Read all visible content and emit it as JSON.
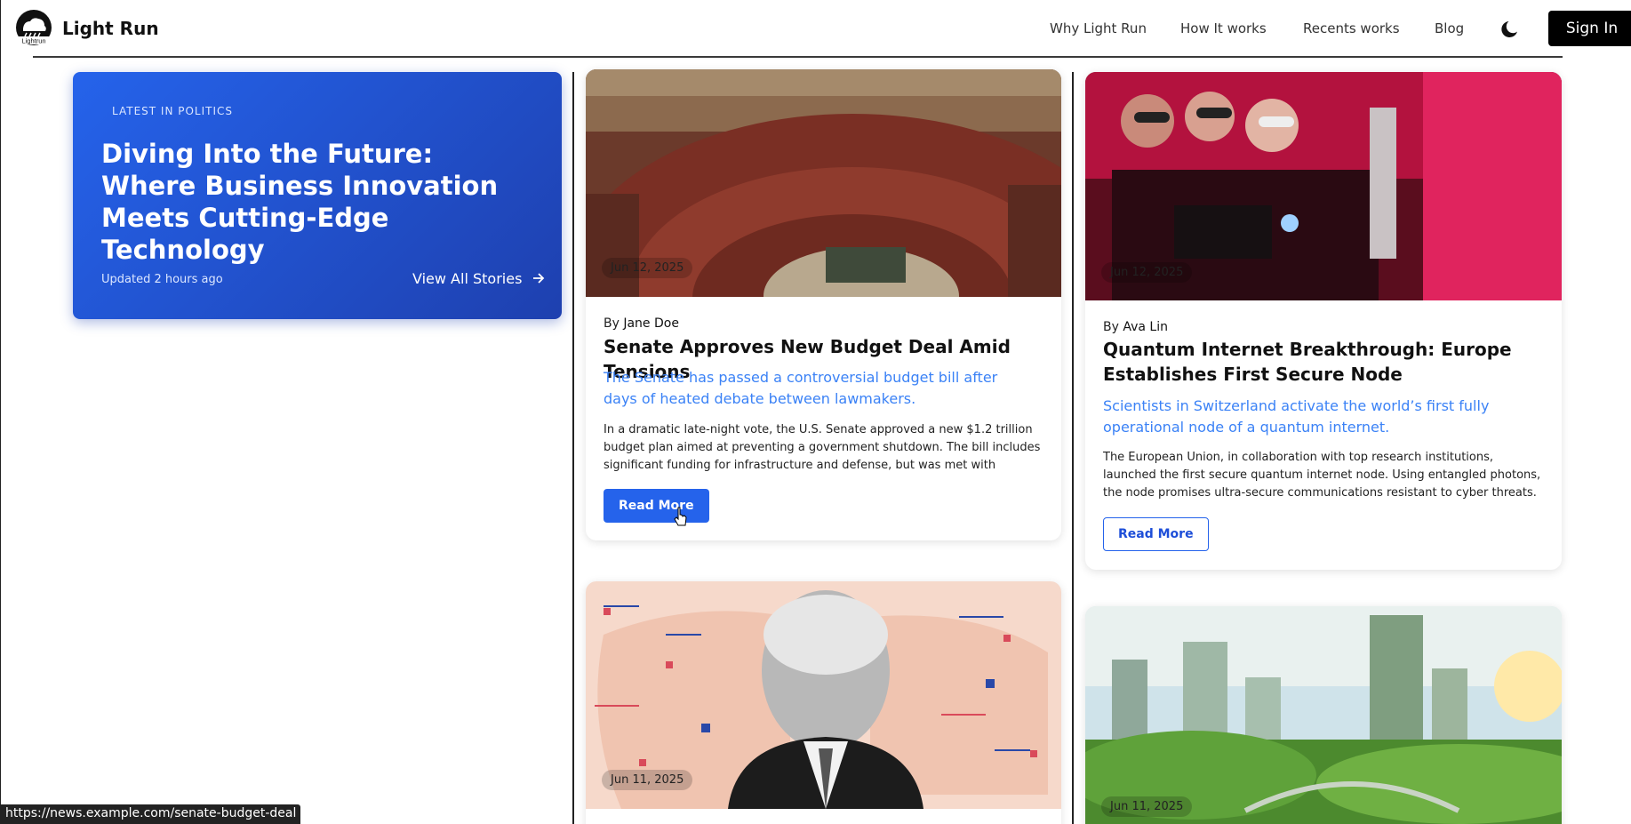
{
  "header": {
    "brand": "Light Run",
    "logo_text": "Lightrun",
    "nav": [
      "Why Light Run",
      "How It works",
      "Recents works",
      "Blog"
    ],
    "signin_label": "Sign In",
    "theme_icon": "moon-icon"
  },
  "hero": {
    "eyebrow": "LATEST IN POLITICS",
    "title": "Diving Into the Future: Where Business Innovation Meets Cutting-Edge Technology",
    "updated": "Updated 2 hours ago",
    "link_label": "View All Stories",
    "link_icon": "arrow-right-icon"
  },
  "cards": [
    {
      "date": "Jun 12, 2025",
      "by_prefix": "By",
      "author": "Jane Doe",
      "title": "Senate Approves New Budget Deal Amid Tensions",
      "subtitle": "The Senate has passed a controversial budget bill after days of heated debate between lawmakers.",
      "body": "In a dramatic late-night vote, the U.S. Senate approved a new $1.2 trillion budget plan aimed at preventing a government shutdown. The bill includes significant funding for infrastructure and defense, but was met with criticism…",
      "button": "Read More"
    },
    {
      "date": "Jun 12, 2025",
      "by_prefix": "By",
      "author": "Ava Lin",
      "title": "Quantum Internet Breakthrough: Europe Establishes First Secure Node",
      "subtitle": "Scientists in Switzerland activate the world’s first fully operational node of a quantum internet.",
      "body": "The European Union, in collaboration with top research institutions, launched the first secure quantum internet node. Using entangled photons, the node promises ultra-secure communications resistant to cyber threats.",
      "button": "Read More"
    },
    {
      "date": "Jun 11, 2025"
    },
    {
      "date": "Jun 11, 2025"
    }
  ],
  "status_bar": {
    "url": "https://news.example.com/senate-budget-deal"
  },
  "colors": {
    "accent": "#2563eb",
    "hero_start": "#2563eb",
    "hero_end": "#1e40af",
    "subtitle": "#3b82f6"
  }
}
